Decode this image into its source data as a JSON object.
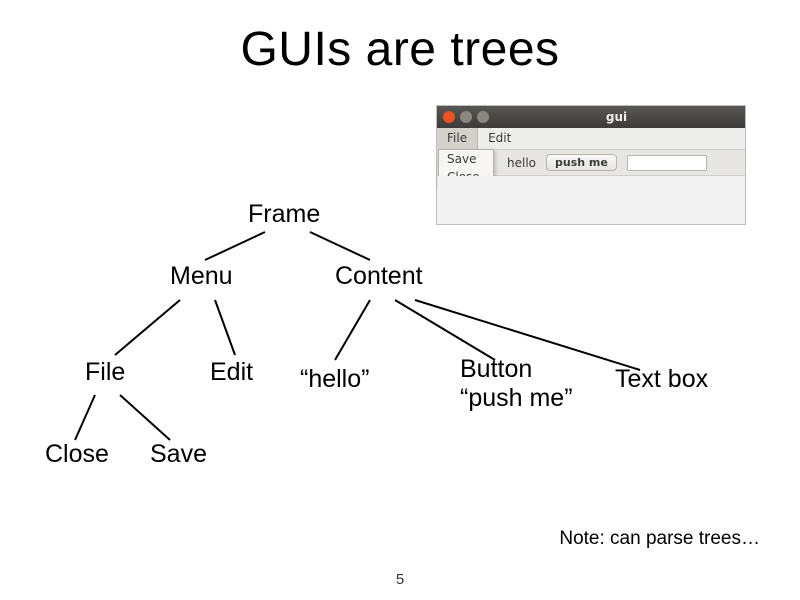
{
  "title": "GUIs are trees",
  "mock": {
    "window_title": "gui",
    "menubar": {
      "file": "File",
      "edit": "Edit"
    },
    "dropdown": {
      "save": "Save",
      "close": "Close"
    },
    "toolbar": {
      "hello": "hello",
      "pushme": "push me"
    }
  },
  "nodes": {
    "frame": "Frame",
    "menu": "Menu",
    "content": "Content",
    "file": "File",
    "edit": "Edit",
    "hello": "“hello”",
    "button_l1": "Button",
    "button_l2": "“push me”",
    "textbox": "Text box",
    "close": "Close",
    "save": "Save"
  },
  "footer_note": "Note: can parse trees…",
  "page_number": "5"
}
